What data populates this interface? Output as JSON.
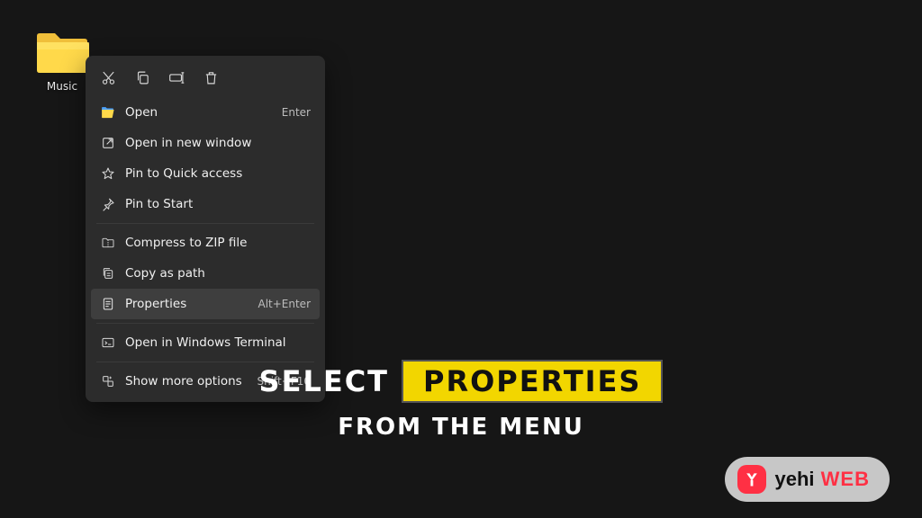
{
  "desktop": {
    "folder_label": "Music"
  },
  "context_menu": {
    "items": [
      {
        "icon": "open-folder-icon",
        "label": "Open",
        "accel": "Enter"
      },
      {
        "icon": "new-window-icon",
        "label": "Open in new window",
        "accel": ""
      },
      {
        "icon": "star-icon",
        "label": "Pin to Quick access",
        "accel": ""
      },
      {
        "icon": "pin-icon",
        "label": "Pin to Start",
        "accel": ""
      },
      {
        "icon": "zip-icon",
        "label": "Compress to ZIP file",
        "accel": ""
      },
      {
        "icon": "copy-path-icon",
        "label": "Copy as path",
        "accel": ""
      },
      {
        "icon": "properties-icon",
        "label": "Properties",
        "accel": "Alt+Enter"
      },
      {
        "icon": "terminal-icon",
        "label": "Open in Windows Terminal",
        "accel": ""
      },
      {
        "icon": "more-options-icon",
        "label": "Show more options",
        "accel": "Shift+F10"
      }
    ]
  },
  "caption": {
    "lead": "SELECT",
    "highlight": "PROPERTIES",
    "tail": "FROM THE MENU"
  },
  "logo": {
    "part_a": "yehi",
    "part_b": " WEB"
  }
}
